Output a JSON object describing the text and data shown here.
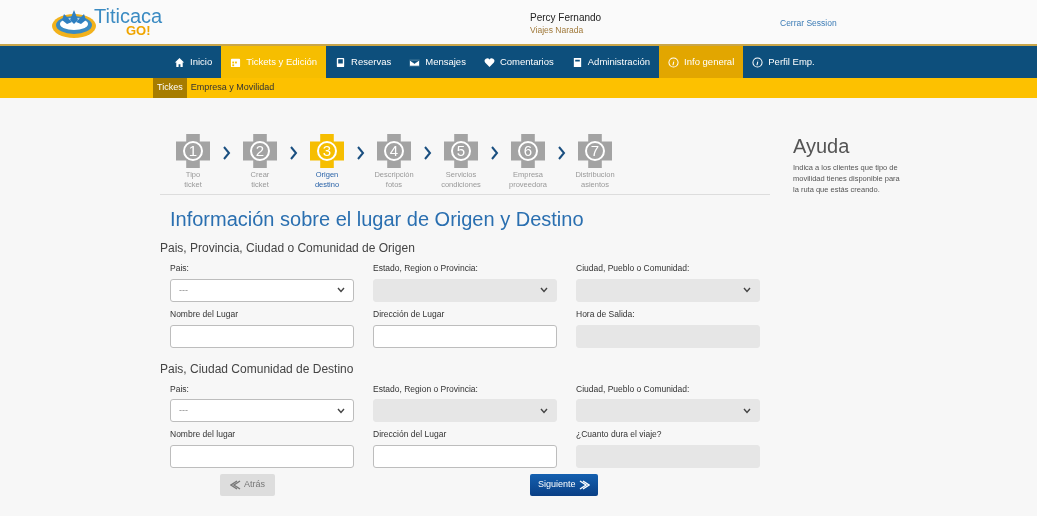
{
  "header": {
    "logo": {
      "name": "Titicaca",
      "tagline": "GO!"
    },
    "user_name": "Percy Fernando",
    "company": "Viajes Narada",
    "logout": "Cerrar Session"
  },
  "nav": [
    {
      "label": "Inicio",
      "kind": "home",
      "selected": false,
      "highlighted": false
    },
    {
      "label": "Tickets y Edición",
      "kind": "calendar",
      "selected": true,
      "highlighted": false
    },
    {
      "label": "Reservas",
      "kind": "tablet",
      "selected": false,
      "highlighted": false
    },
    {
      "label": "Mensajes",
      "kind": "envelope",
      "selected": false,
      "highlighted": false
    },
    {
      "label": "Comentarios",
      "kind": "heart",
      "selected": false,
      "highlighted": false
    },
    {
      "label": "Administración",
      "kind": "document",
      "selected": false,
      "highlighted": false
    },
    {
      "label": "Info general",
      "kind": "info",
      "selected": false,
      "highlighted": true
    },
    {
      "label": "Perfil Emp.",
      "kind": "info",
      "selected": false,
      "highlighted": false
    }
  ],
  "subnav": [
    {
      "label": "Tickes",
      "selected": true
    },
    {
      "label": "Empresa y Movilidad",
      "selected": false
    }
  ],
  "steps": [
    {
      "number": "1",
      "label": "Tipo ticket",
      "selected": false
    },
    {
      "number": "2",
      "label": "Crear ticket",
      "selected": false
    },
    {
      "number": "3",
      "label": "Origen destino",
      "selected": true
    },
    {
      "number": "4",
      "label": "Descripción fotos",
      "selected": false
    },
    {
      "number": "5",
      "label": "Servicios condiciones",
      "selected": false
    },
    {
      "number": "6",
      "label": "Empresa proveedora",
      "selected": false
    },
    {
      "number": "7",
      "label": "Distribucion asientos",
      "selected": false
    }
  ],
  "title": "Información sobre el lugar de Origen y Destino",
  "sections": [
    {
      "heading": "Pais, Provincia, Ciudad o Comunidad de Origen",
      "fields": [
        {
          "label": "Pais:",
          "kind": "select",
          "value": "---",
          "disabled": false
        },
        {
          "label": "Estado, Region o Provincia:",
          "kind": "select",
          "disabled": true
        },
        {
          "label": "Ciudad, Pueblo o Comunidad:",
          "kind": "select",
          "disabled": true
        },
        {
          "label": "Nombre del Lugar",
          "kind": "input",
          "disabled": false
        },
        {
          "label": "Dirección de Lugar",
          "kind": "input",
          "disabled": false
        },
        {
          "label": "Hora de Salida:",
          "kind": "input",
          "disabled": true
        }
      ]
    },
    {
      "heading": "Pais, Ciudad Comunidad de Destino",
      "fields": [
        {
          "label": "Pais:",
          "kind": "select",
          "value": "---",
          "disabled": false
        },
        {
          "label": "Estado, Region o Provincia:",
          "kind": "select",
          "disabled": true
        },
        {
          "label": "Ciudad, Pueblo o Comunidad:",
          "kind": "select",
          "disabled": true
        },
        {
          "label": "Nombre del lugar",
          "kind": "input",
          "disabled": false
        },
        {
          "label": "Dirección del Lugar",
          "kind": "input",
          "disabled": false
        },
        {
          "label": "¿Cuanto dura el viaje?",
          "kind": "input",
          "disabled": true
        }
      ]
    }
  ],
  "buttons": {
    "back": {
      "label": "Atrás",
      "disabled": true
    },
    "next": {
      "label": "Siguiente",
      "disabled": false
    }
  },
  "help": {
    "title": "Ayuda",
    "text": "Indica a los clientes que tipo de movilidad tienes disponible para la ruta que estás creando."
  }
}
